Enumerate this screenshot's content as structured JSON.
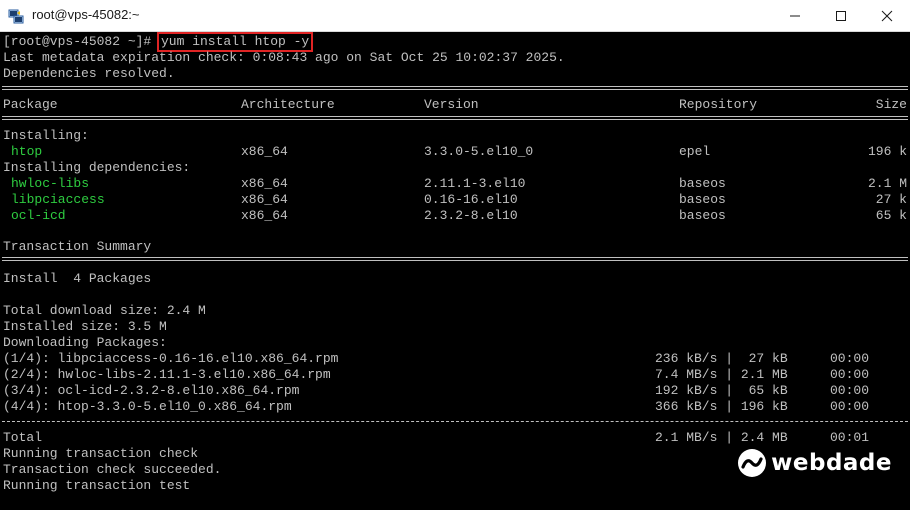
{
  "window": {
    "title": "root@vps-45082:~",
    "controls": {
      "minimize_icon": "minimize-icon",
      "maximize_icon": "maximize-icon",
      "close_icon": "close-icon"
    }
  },
  "terminal": {
    "prompt": "[root@vps-45082 ~]#",
    "command": "yum install htop -y",
    "meta_line": "Last metadata expiration check: 0:08:43 ago on Sat Oct 25 10:02:37 2025.",
    "deps_resolved": "Dependencies resolved.",
    "table": {
      "headers": [
        "Package",
        "Architecture",
        "Version",
        "Repository",
        "Size"
      ],
      "installing_label": "Installing:",
      "installing": [
        {
          "name": "htop",
          "arch": "x86_64",
          "version": "3.3.0-5.el10_0",
          "repo": "epel",
          "size": "196 k"
        }
      ],
      "deps_label": "Installing dependencies:",
      "deps": [
        {
          "name": "hwloc-libs",
          "arch": "x86_64",
          "version": "2.11.1-3.el10",
          "repo": "baseos",
          "size": "2.1 M"
        },
        {
          "name": "libpciaccess",
          "arch": "x86_64",
          "version": "0.16-16.el10",
          "repo": "baseos",
          "size": "27 k"
        },
        {
          "name": "ocl-icd",
          "arch": "x86_64",
          "version": "2.3.2-8.el10",
          "repo": "baseos",
          "size": "65 k"
        }
      ]
    },
    "summary_label": "Transaction Summary",
    "install_count": "Install  4 Packages",
    "total_download": "Total download size: 2.4 M",
    "installed_size": "Installed size: 3.5 M",
    "downloading_label": "Downloading Packages:",
    "downloads": [
      {
        "name": "(1/4): libpciaccess-0.16-16.el10.x86_64.rpm",
        "speed": "236 kB/s |  27 kB",
        "time": "00:00"
      },
      {
        "name": "(2/4): hwloc-libs-2.11.1-3.el10.x86_64.rpm",
        "speed": "7.4 MB/s | 2.1 MB",
        "time": "00:00"
      },
      {
        "name": "(3/4): ocl-icd-2.3.2-8.el10.x86_64.rpm",
        "speed": "192 kB/s |  65 kB",
        "time": "00:00"
      },
      {
        "name": "(4/4): htop-3.3.0-5.el10_0.x86_64.rpm",
        "speed": "366 kB/s | 196 kB",
        "time": "00:00"
      }
    ],
    "total": {
      "label": "Total",
      "speed": "2.1 MB/s | 2.4 MB",
      "time": "00:01"
    },
    "tail": [
      "Running transaction check",
      "Transaction check succeeded.",
      "Running transaction test"
    ]
  },
  "logo": {
    "text": "webdade",
    "icon": "webdade-logo-icon"
  },
  "colors": {
    "package_green": "#2ecc40",
    "highlight_red": "#e02424",
    "text_gray": "#c0c0c0"
  }
}
